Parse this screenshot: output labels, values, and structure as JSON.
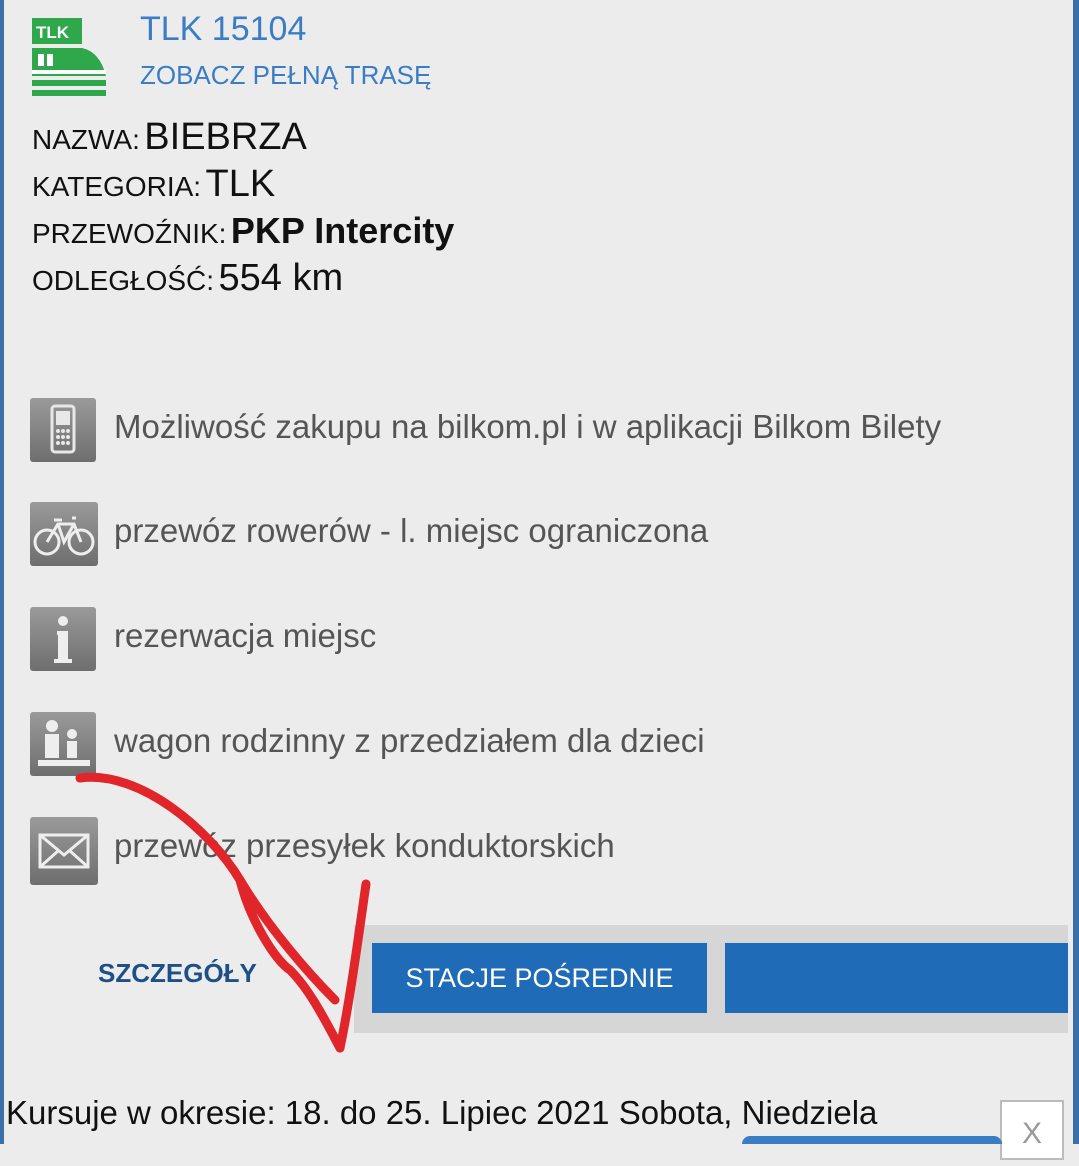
{
  "train": {
    "logo_text": "TLK",
    "number": "TLK 15104",
    "route_link": "ZOBACZ PEŁNĄ TRASĘ"
  },
  "info": {
    "name_label": "NAZWA:",
    "name_value": "BIEBRZA",
    "category_label": "KATEGORIA:",
    "category_value": "TLK",
    "carrier_label": "PRZEWOŹNIK:",
    "carrier_value": "PKP Intercity",
    "distance_label": "ODLEGŁOŚĆ:",
    "distance_value": "554  km"
  },
  "features": [
    {
      "icon": "mobile-phone-icon",
      "text": "Możliwość zakupu na bilkom.pl i w aplikacji Bilkom Bilety"
    },
    {
      "icon": "bicycle-icon",
      "text": "przewóz rowerów - l. miejsc ograniczona"
    },
    {
      "icon": "info-icon",
      "text": "rezerwacja miejsc"
    },
    {
      "icon": "family-icon",
      "text": "wagon rodzinny z przedziałem dla dzieci"
    },
    {
      "icon": "envelope-icon",
      "text": "przewóz przesyłek konduktorskich"
    }
  ],
  "tabs": {
    "details": "SZCZEGÓŁY",
    "stations": "STACJE POŚREDNIE"
  },
  "schedule": "Kursuje w okresie: 18. do 25. Lipiec 2021 Sobota, Niedziela",
  "close_label": "X",
  "colors": {
    "link_blue": "#3b7dc4",
    "tab_blue": "#1f6bb7",
    "annotation_red": "#e0262a",
    "logo_green": "#2ea84a"
  }
}
